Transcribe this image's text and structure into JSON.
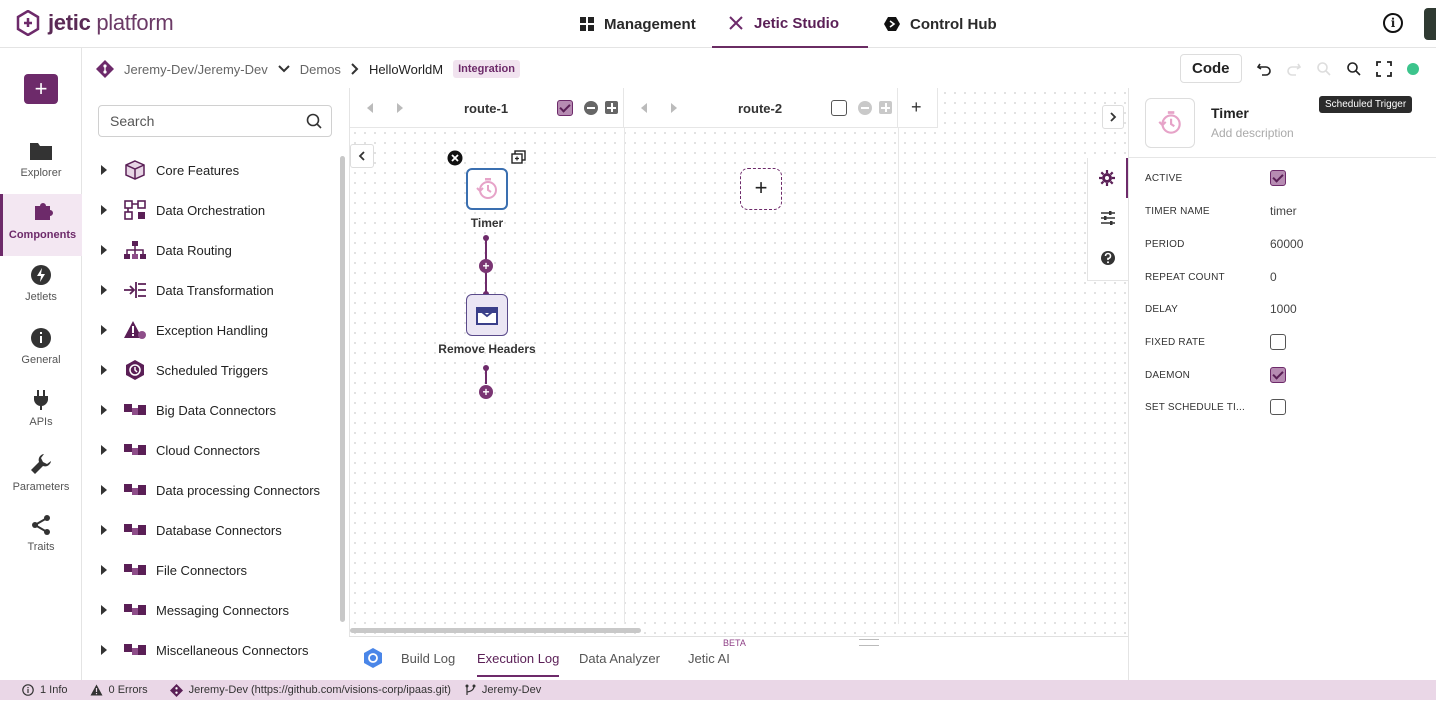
{
  "app": {
    "logo_bold": "jetic",
    "logo_light": "platform"
  },
  "topnav": {
    "management": "Management",
    "studio": "Jetic Studio",
    "control_hub": "Control Hub"
  },
  "leftnav": {
    "add_label": "+",
    "items": [
      {
        "label": "Explorer",
        "icon": "folder-icon"
      },
      {
        "label": "Components",
        "icon": "puzzle-icon"
      },
      {
        "label": "Jetlets",
        "icon": "bolt-icon"
      },
      {
        "label": "General",
        "icon": "info-icon"
      },
      {
        "label": "APIs",
        "icon": "plug-icon"
      },
      {
        "label": "Parameters",
        "icon": "wrench-icon"
      },
      {
        "label": "Traits",
        "icon": "share-icon"
      }
    ]
  },
  "breadcrumb": {
    "repo": "Jeremy-Dev/Jeremy-Dev",
    "folder": "Demos",
    "file": "HelloWorldM",
    "badge": "Integration"
  },
  "toolbar": {
    "code_label": "Code"
  },
  "palette": {
    "search_placeholder": "Search",
    "categories": [
      "Core Features",
      "Data Orchestration",
      "Data Routing",
      "Data Transformation",
      "Exception Handling",
      "Scheduled Triggers",
      "Big Data Connectors",
      "Cloud Connectors",
      "Data processing Connectors",
      "Database Connectors",
      "File Connectors",
      "Messaging Connectors",
      "Miscellaneous Connectors"
    ]
  },
  "routes": [
    {
      "name": "route-1",
      "checked": true
    },
    {
      "name": "route-2",
      "checked": false
    }
  ],
  "add_route_label": "+",
  "nodes": {
    "timer": "Timer",
    "remove_headers": "Remove Headers"
  },
  "bottom_tabs": {
    "build_log": "Build Log",
    "execution_log": "Execution Log",
    "data_analyzer": "Data Analyzer",
    "jetic_ai": "Jetic AI",
    "beta": "BETA"
  },
  "properties": {
    "title": "Timer",
    "description_placeholder": "Add description",
    "tooltip": "Scheduled Trigger",
    "fields": [
      {
        "label": "ACTIVE",
        "type": "checkbox",
        "value": true
      },
      {
        "label": "TIMER NAME",
        "type": "text",
        "value": "timer"
      },
      {
        "label": "PERIOD",
        "type": "text",
        "value": "60000"
      },
      {
        "label": "REPEAT COUNT",
        "type": "text",
        "value": "0"
      },
      {
        "label": "DELAY",
        "type": "text",
        "value": "1000"
      },
      {
        "label": "FIXED RATE",
        "type": "checkbox",
        "value": false
      },
      {
        "label": "DAEMON",
        "type": "checkbox",
        "value": true
      },
      {
        "label": "SET SCHEDULE TI...",
        "type": "checkbox",
        "value": false
      }
    ]
  },
  "status": {
    "info": "1 Info",
    "errors": "0 Errors",
    "repo": "Jeremy-Dev (https://github.com/visions-corp/ipaas.git)",
    "branch": "Jeremy-Dev"
  },
  "colors": {
    "brand": "#6d2a6a",
    "status_bar": "#ead7e7",
    "node_border": "#3a6fb0"
  }
}
